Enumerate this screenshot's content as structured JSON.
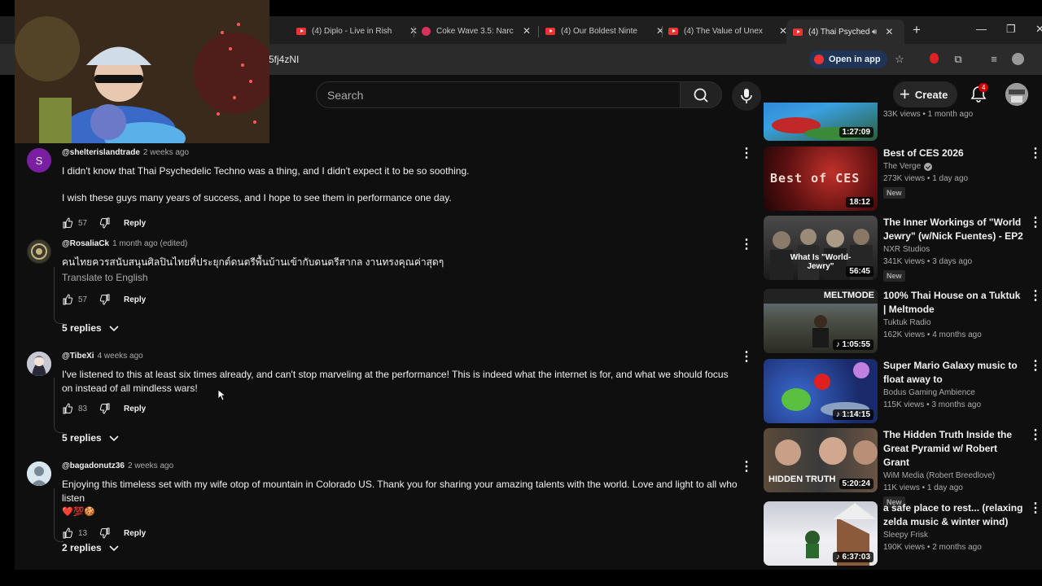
{
  "browser": {
    "tabs": [
      {
        "label": "(4) Diplo - Live in Rish",
        "icon": "youtube-icon"
      },
      {
        "label": "Coke Wave 3.5: Narc",
        "icon": "podcasts-icon"
      },
      {
        "label": "(4) Our Boldest Ninte",
        "icon": "youtube-icon"
      },
      {
        "label": "(4) The Value of Unex",
        "icon": "youtube-icon"
      },
      {
        "label": "(4) Thai Psychede",
        "icon": "youtube-icon"
      }
    ],
    "url": "5fj4zNI",
    "open_in_app": "Open in app"
  },
  "header": {
    "search_placeholder": "Search",
    "create_label": "Create",
    "notification_count": "4"
  },
  "comments": [
    {
      "author": "@shelterislandtrade",
      "time": "2 weeks ago",
      "text": "I didn't know that Thai Psychedelic Techno was a thing, and I didn't expect it to be so soothing.",
      "text2": "I wish these guys many years of success, and I hope to see them in performance one day.",
      "likes": "57",
      "reply": "Reply",
      "avatar_letter": "S",
      "avatar_color": "#7b1fa2"
    },
    {
      "author": "@RosaliaCk",
      "time": "1 month ago (edited)",
      "text": "คนไทยควรสนับสนุนศิลปินไทยที่ประยุกต์ดนตรีพื้นบ้านเข้ากับดนตรีสากล งานทรงคุณค่าสุดๆ",
      "translate": "Translate to English",
      "likes": "57",
      "reply": "Reply",
      "replies": "5 replies"
    },
    {
      "author": "@TibeXi",
      "time": "4 weeks ago",
      "text": "I've listened to this at least six times already, and can't stop marveling at the performance! This is indeed what the internet is for, and what we should focus on instead of all mindless wars!",
      "likes": "83",
      "reply": "Reply",
      "replies": "5 replies"
    },
    {
      "author": "@bagadonutz36",
      "time": "2 weeks ago",
      "text": "Enjoying this timeless set with my wife otop of mountain in Colorado US. Thank you for sharing your amazing talents with the world. Love and light to all who listen",
      "emoji": "❤️💯🍪",
      "likes": "13",
      "reply": "Reply",
      "replies": "2 replies"
    }
  ],
  "sidebar": [
    {
      "title": "",
      "channel": "",
      "meta": "33K views • 1 month ago",
      "duration": "1:27:09",
      "badge": ""
    },
    {
      "title": "Best of CES 2026",
      "channel": "The Verge",
      "verified": true,
      "meta": "273K views • 1 day ago",
      "duration": "18:12",
      "badge": "New",
      "thumb_text": "Best of CES"
    },
    {
      "title": "The Inner Workings of \"World Jewry\" (w/Nick Fuentes) - EP2",
      "channel": "NXR Studios",
      "meta": "341K views • 3 days ago",
      "duration": "56:45",
      "badge": "New",
      "thumb_text": "What Is \"World-Jewry\""
    },
    {
      "title": "100% Thai House on a Tuktuk | Meltmode",
      "channel": "Tuktuk Radio",
      "meta": "162K views • 4 months ago",
      "duration": "1:05:55",
      "badge": "",
      "thumb_text": "MELTMODE"
    },
    {
      "title": "Super Mario Galaxy music to float away to",
      "channel": "Bodus Gaming Ambience",
      "meta": "115K views • 3 months ago",
      "duration": "1:14:15",
      "badge": ""
    },
    {
      "title": "The Hidden Truth Inside the Great Pyramid w/ Robert Grant",
      "channel": "WiM Media (Robert Breedlove)",
      "meta": "11K views • 1 day ago",
      "duration": "5:20:24",
      "badge": "New",
      "thumb_text": "HIDDEN TRUTH"
    },
    {
      "title": "a safe place to rest... (relaxing zelda music & winter wind)",
      "channel": "Sleepy Frisk",
      "meta": "190K views • 2 months ago",
      "duration": "6:37:03",
      "badge": ""
    }
  ]
}
